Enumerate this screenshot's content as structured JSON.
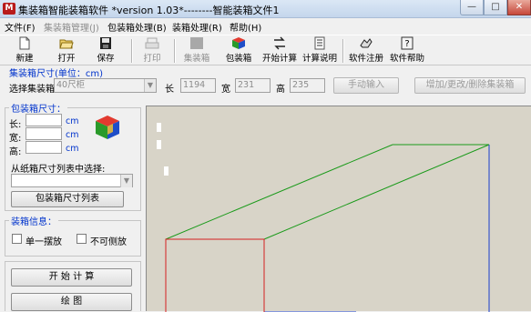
{
  "window": {
    "title": "集装箱智能装箱软件   *version 1.03*--------智能装箱文件1",
    "icon_text": "M",
    "min_glyph": "—",
    "max_glyph": "□",
    "close_glyph": "✕"
  },
  "menu": [
    {
      "label": "文件(F)"
    },
    {
      "label": "集装箱管理(J)",
      "disabled": true
    },
    {
      "label": "包装箱处理(B)"
    },
    {
      "label": "装箱处理(R)"
    },
    {
      "label": "帮助(H)"
    }
  ],
  "toolbar": {
    "new": "新建",
    "open": "打开",
    "save": "保存",
    "print": "打印",
    "container": "集装箱",
    "package": "包装箱",
    "start_calc": "开始计算",
    "calc_help": "计算说明",
    "register": "软件注册",
    "help": "软件帮助"
  },
  "container_size": {
    "title": "集装箱尺寸(单位：cm)",
    "select_label": "选择集装箱",
    "selected": "40尺柜",
    "length_label": "长",
    "length": "1194",
    "width_label": "宽",
    "width": "231",
    "height_label": "高",
    "height": "235",
    "manual_btn": "手动输入",
    "edit_btn": "增加/更改/删除集装箱"
  },
  "package_size": {
    "title": "包装箱尺寸：",
    "length_label": "长:",
    "width_label": "宽:",
    "height_label": "高:",
    "unit": "cm",
    "select_from_list": "从纸箱尺寸列表中选择:",
    "list_btn": "包装箱尺寸列表"
  },
  "packing_info": {
    "title": "装箱信息：",
    "single_layer": "单一摆放",
    "no_side": "不可侧放"
  },
  "actions": {
    "start_calc": "开 始 计 算",
    "draw": "绘    图"
  },
  "colors": {
    "container_top_edges": "#1a9a1a",
    "container_right_edge": "#1a3ecc",
    "container_front_face": "#d42020",
    "canvas_bg": "#d8d4c8",
    "label_blue": "#0033cc"
  }
}
